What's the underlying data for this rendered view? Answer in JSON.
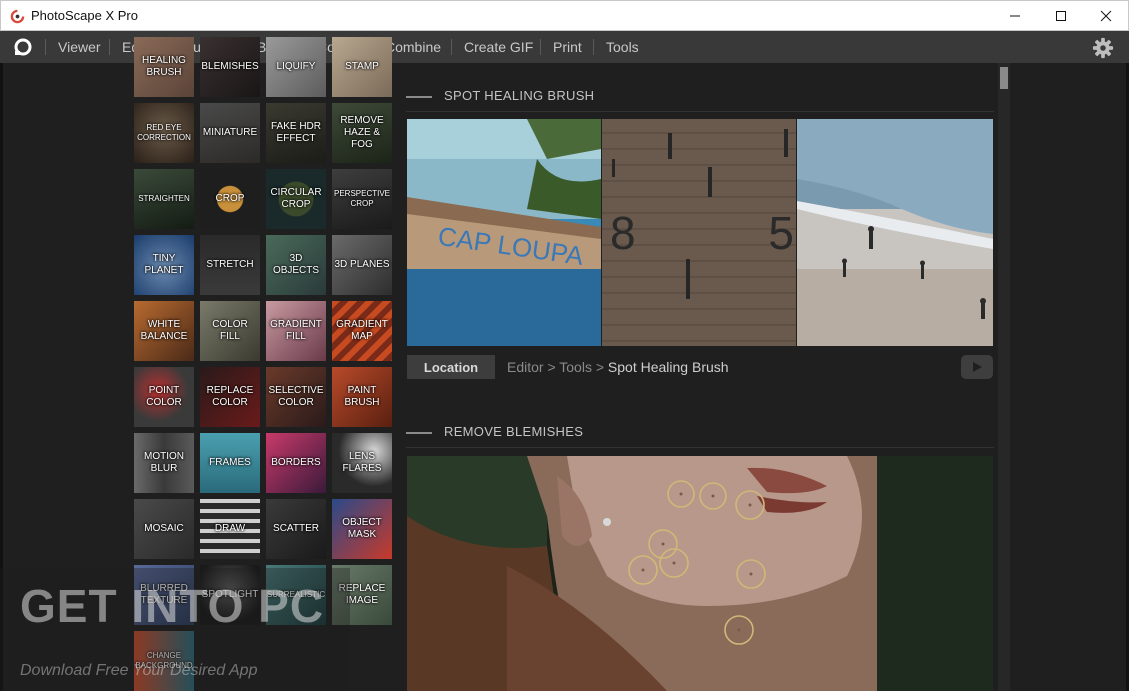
{
  "window": {
    "title": "PhotoScape X Pro"
  },
  "menu": {
    "items": [
      "Viewer",
      "Editor",
      "Cut Out",
      "Batch",
      "Collage",
      "Combine",
      "Create GIF",
      "Print",
      "Tools"
    ]
  },
  "tools": [
    [
      "HEALING BRUSH",
      "BLEMISHES",
      "LIQUIFY",
      "STAMP"
    ],
    [
      "RED EYE CORRECTION",
      "MINIATURE",
      "FAKE HDR EFFECT",
      "REMOVE HAZE & FOG"
    ],
    [
      "STRAIGHTEN",
      "CROP",
      "CIRCULAR CROP",
      "PERSPECTIVE CROP"
    ],
    [
      "TINY PLANET",
      "STRETCH",
      "3D OBJECTS",
      "3D PLANES"
    ],
    [
      "WHITE BALANCE",
      "COLOR FILL",
      "GRADIENT FILL",
      "GRADIENT MAP"
    ],
    [
      "POINT COLOR",
      "REPLACE COLOR",
      "SELECTIVE COLOR",
      "PAINT BRUSH"
    ],
    [
      "MOTION BLUR",
      "FRAMES",
      "BORDERS",
      "LENS FLARES"
    ],
    [
      "MOSAIC",
      "DRAW",
      "SCATTER",
      "OBJECT MASK"
    ],
    [
      "BLURRED TEXTURE",
      "SPOTLIGHT",
      "SURREALISTIC",
      "REPLACE IMAGE"
    ],
    [
      "CHANGE BACKGROUND"
    ]
  ],
  "sections": {
    "spot_healing": {
      "title": "SPOT HEALING BRUSH",
      "photo_text_boat": "CAP LOUPA",
      "photo_text_wall": "8 5"
    },
    "location": {
      "button": "Location",
      "path_prefix": "Editor > Tools > ",
      "current": "Spot Healing Brush"
    },
    "remove_blemishes": {
      "title": "REMOVE BLEMISHES"
    }
  },
  "watermark": {
    "title": "GET INTO PC",
    "subtitle": "Download Free Your Desired App"
  },
  "colors": {
    "background": "#1f1f1f",
    "menubar": "#393939",
    "titlebar": "#ffffff",
    "accent": "#d84a3c"
  }
}
